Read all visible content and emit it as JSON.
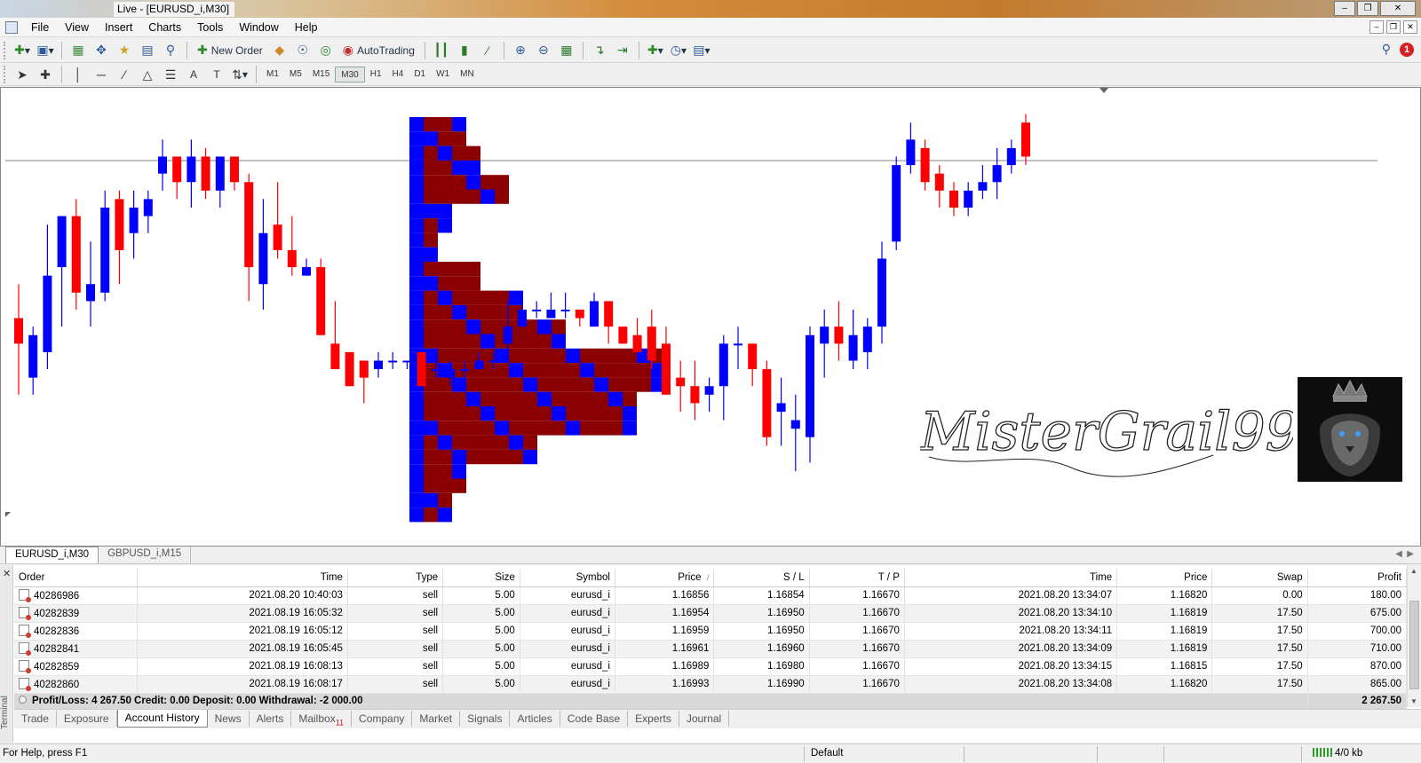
{
  "window": {
    "title": "Live - [EURUSD_i,M30]"
  },
  "menu": [
    "File",
    "View",
    "Insert",
    "Charts",
    "Tools",
    "Window",
    "Help"
  ],
  "toolbar": {
    "new_order": "New Order",
    "auto_trading": "AutoTrading",
    "timeframes": [
      "M1",
      "M5",
      "M15",
      "M30",
      "H1",
      "H4",
      "D1",
      "W1",
      "MN"
    ],
    "active_timeframe": "M30",
    "notification_count": "1"
  },
  "chart": {
    "watermark": "MisterGrail999©",
    "candles": [
      {
        "o": 1.1687,
        "h": 1.1691,
        "l": 1.1678,
        "c": 1.1684
      },
      {
        "o": 1.168,
        "h": 1.1686,
        "l": 1.1678,
        "c": 1.1685
      },
      {
        "o": 1.1683,
        "h": 1.1698,
        "l": 1.1681,
        "c": 1.1692
      },
      {
        "o": 1.1693,
        "h": 1.1699,
        "l": 1.1686,
        "c": 1.1699
      },
      {
        "o": 1.1699,
        "h": 1.1701,
        "l": 1.1688,
        "c": 1.169
      },
      {
        "o": 1.1689,
        "h": 1.1696,
        "l": 1.1686,
        "c": 1.1691
      },
      {
        "o": 1.169,
        "h": 1.1702,
        "l": 1.1689,
        "c": 1.17
      },
      {
        "o": 1.1701,
        "h": 1.1702,
        "l": 1.1691,
        "c": 1.1695
      },
      {
        "o": 1.1697,
        "h": 1.1702,
        "l": 1.1694,
        "c": 1.17
      },
      {
        "o": 1.1699,
        "h": 1.1702,
        "l": 1.1697,
        "c": 1.1701
      },
      {
        "o": 1.1704,
        "h": 1.1708,
        "l": 1.1702,
        "c": 1.1706
      },
      {
        "o": 1.1706,
        "h": 1.1706,
        "l": 1.1701,
        "c": 1.1703
      },
      {
        "o": 1.1703,
        "h": 1.1708,
        "l": 1.17,
        "c": 1.1706
      },
      {
        "o": 1.1706,
        "h": 1.1707,
        "l": 1.1701,
        "c": 1.1702
      },
      {
        "o": 1.1702,
        "h": 1.1706,
        "l": 1.17,
        "c": 1.1706
      },
      {
        "o": 1.1706,
        "h": 1.1706,
        "l": 1.1702,
        "c": 1.1703
      },
      {
        "o": 1.1703,
        "h": 1.1704,
        "l": 1.1689,
        "c": 1.1693
      },
      {
        "o": 1.1691,
        "h": 1.1701,
        "l": 1.1688,
        "c": 1.1697
      },
      {
        "o": 1.1698,
        "h": 1.1703,
        "l": 1.1694,
        "c": 1.1695
      },
      {
        "o": 1.1695,
        "h": 1.1699,
        "l": 1.1692,
        "c": 1.1693
      },
      {
        "o": 1.1692,
        "h": 1.1694,
        "l": 1.1692,
        "c": 1.1693
      },
      {
        "o": 1.1693,
        "h": 1.1694,
        "l": 1.1685,
        "c": 1.1685
      },
      {
        "o": 1.1684,
        "h": 1.1689,
        "l": 1.1682,
        "c": 1.1681
      },
      {
        "o": 1.1683,
        "h": 1.1681,
        "l": 1.1679,
        "c": 1.1679
      },
      {
        "o": 1.1682,
        "h": 1.168,
        "l": 1.1677,
        "c": 1.168
      },
      {
        "o": 1.1681,
        "h": 1.1683,
        "l": 1.168,
        "c": 1.1682
      },
      {
        "o": 1.1682,
        "h": 1.1683,
        "l": 1.1681,
        "c": 1.1682
      },
      {
        "o": 1.1682,
        "h": 1.1681,
        "l": 1.1681,
        "c": 1.1682
      },
      {
        "o": 1.1683,
        "h": 1.1681,
        "l": 1.168,
        "c": 1.1679
      },
      {
        "o": 1.1681,
        "h": 1.1683,
        "l": 1.168,
        "c": 1.1681
      },
      {
        "o": 1.168,
        "h": 1.1682,
        "l": 1.1679,
        "c": 1.1681
      },
      {
        "o": 1.1681,
        "h": 1.1682,
        "l": 1.168,
        "c": 1.1681
      },
      {
        "o": 1.1681,
        "h": 1.1683,
        "l": 1.1681,
        "c": 1.1682
      },
      {
        "o": 1.1682,
        "h": 1.1683,
        "l": 1.1681,
        "c": 1.1682
      },
      {
        "o": 1.1684,
        "h": 1.1689,
        "l": 1.1683,
        "c": 1.1686
      },
      {
        "o": 1.1686,
        "h": 1.1689,
        "l": 1.1686,
        "c": 1.1688
      },
      {
        "o": 1.1688,
        "h": 1.1689,
        "l": 1.1687,
        "c": 1.1688
      },
      {
        "o": 1.1687,
        "h": 1.169,
        "l": 1.1687,
        "c": 1.1688
      },
      {
        "o": 1.1688,
        "h": 1.169,
        "l": 1.1687,
        "c": 1.1688
      },
      {
        "o": 1.1688,
        "h": 1.1688,
        "l": 1.1686,
        "c": 1.1687
      },
      {
        "o": 1.1686,
        "h": 1.169,
        "l": 1.1686,
        "c": 1.1689
      },
      {
        "o": 1.1689,
        "h": 1.1689,
        "l": 1.1684,
        "c": 1.1686
      },
      {
        "o": 1.1686,
        "h": 1.1686,
        "l": 1.1684,
        "c": 1.1684
      },
      {
        "o": 1.1685,
        "h": 1.1687,
        "l": 1.1683,
        "c": 1.1683
      },
      {
        "o": 1.1686,
        "h": 1.1688,
        "l": 1.1681,
        "c": 1.1682
      },
      {
        "o": 1.1684,
        "h": 1.1686,
        "l": 1.1678,
        "c": 1.1678
      },
      {
        "o": 1.168,
        "h": 1.1682,
        "l": 1.1676,
        "c": 1.1679
      },
      {
        "o": 1.1679,
        "h": 1.1682,
        "l": 1.1675,
        "c": 1.1677
      },
      {
        "o": 1.1678,
        "h": 1.168,
        "l": 1.1676,
        "c": 1.1679
      },
      {
        "o": 1.1679,
        "h": 1.1685,
        "l": 1.1675,
        "c": 1.1684
      },
      {
        "o": 1.1684,
        "h": 1.1686,
        "l": 1.1681,
        "c": 1.1684
      },
      {
        "o": 1.1684,
        "h": 1.1684,
        "l": 1.1679,
        "c": 1.1681
      },
      {
        "o": 1.1681,
        "h": 1.1682,
        "l": 1.1672,
        "c": 1.1673
      },
      {
        "o": 1.1676,
        "h": 1.168,
        "l": 1.1672,
        "c": 1.1677
      },
      {
        "o": 1.1674,
        "h": 1.1678,
        "l": 1.1669,
        "c": 1.1675
      },
      {
        "o": 1.1673,
        "h": 1.1686,
        "l": 1.167,
        "c": 1.1685
      },
      {
        "o": 1.1684,
        "h": 1.1688,
        "l": 1.168,
        "c": 1.1686
      },
      {
        "o": 1.1686,
        "h": 1.1689,
        "l": 1.1682,
        "c": 1.1684
      },
      {
        "o": 1.1682,
        "h": 1.1688,
        "l": 1.1681,
        "c": 1.1685
      },
      {
        "o": 1.1683,
        "h": 1.1687,
        "l": 1.1681,
        "c": 1.1686
      },
      {
        "o": 1.1686,
        "h": 1.1696,
        "l": 1.1684,
        "c": 1.1694
      },
      {
        "o": 1.1696,
        "h": 1.1706,
        "l": 1.1695,
        "c": 1.1705
      },
      {
        "o": 1.1705,
        "h": 1.171,
        "l": 1.1704,
        "c": 1.1708
      },
      {
        "o": 1.1707,
        "h": 1.1708,
        "l": 1.1702,
        "c": 1.1703
      },
      {
        "o": 1.1704,
        "h": 1.1705,
        "l": 1.17,
        "c": 1.1702
      },
      {
        "o": 1.1702,
        "h": 1.1703,
        "l": 1.1699,
        "c": 1.17
      },
      {
        "o": 1.17,
        "h": 1.1703,
        "l": 1.1699,
        "c": 1.1702
      },
      {
        "o": 1.1702,
        "h": 1.1705,
        "l": 1.1701,
        "c": 1.1703
      },
      {
        "o": 1.1703,
        "h": 1.1707,
        "l": 1.1701,
        "c": 1.1705
      },
      {
        "o": 1.1705,
        "h": 1.1708,
        "l": 1.1704,
        "c": 1.1707
      },
      {
        "o": 1.171,
        "h": 1.1711,
        "l": 1.1705,
        "c": 1.1706
      }
    ]
  },
  "chart_tabs": [
    "EURUSD_i,M30",
    "GBPUSD_i,M15"
  ],
  "terminal": {
    "side_label": "Terminal",
    "columns": [
      "Order",
      "Time",
      "Type",
      "Size",
      "Symbol",
      "Price",
      "S / L",
      "T / P",
      "Time",
      "Price",
      "Swap",
      "Profit"
    ],
    "sort_indicator": "/",
    "rows": [
      [
        "40286986",
        "2021.08.20 10:40:03",
        "sell",
        "5.00",
        "eurusd_i",
        "1.16856",
        "1.16854",
        "1.16670",
        "2021.08.20 13:34:07",
        "1.16820",
        "0.00",
        "180.00"
      ],
      [
        "40282839",
        "2021.08.19 16:05:32",
        "sell",
        "5.00",
        "eurusd_i",
        "1.16954",
        "1.16950",
        "1.16670",
        "2021.08.20 13:34:10",
        "1.16819",
        "17.50",
        "675.00"
      ],
      [
        "40282836",
        "2021.08.19 16:05:12",
        "sell",
        "5.00",
        "eurusd_i",
        "1.16959",
        "1.16950",
        "1.16670",
        "2021.08.20 13:34:11",
        "1.16819",
        "17.50",
        "700.00"
      ],
      [
        "40282841",
        "2021.08.19 16:05:45",
        "sell",
        "5.00",
        "eurusd_i",
        "1.16961",
        "1.16960",
        "1.16670",
        "2021.08.20 13:34:09",
        "1.16819",
        "17.50",
        "710.00"
      ],
      [
        "40282859",
        "2021.08.19 16:08:13",
        "sell",
        "5.00",
        "eurusd_i",
        "1.16989",
        "1.16980",
        "1.16670",
        "2021.08.20 13:34:15",
        "1.16815",
        "17.50",
        "870.00"
      ],
      [
        "40282860",
        "2021.08.19 16:08:17",
        "sell",
        "5.00",
        "eurusd_i",
        "1.16993",
        "1.16990",
        "1.16670",
        "2021.08.20 13:34:08",
        "1.16820",
        "17.50",
        "865.00"
      ]
    ],
    "summary": "Profit/Loss: 4 267.50  Credit: 0.00  Deposit: 0.00  Withdrawal: -2 000.00",
    "summary_total": "2 267.50",
    "tabs": [
      "Trade",
      "Exposure",
      "Account History",
      "News",
      "Alerts",
      "Mailbox",
      "Company",
      "Market",
      "Signals",
      "Articles",
      "Code Base",
      "Experts",
      "Journal"
    ],
    "active_tab": "Account History",
    "mailbox_count": "11"
  },
  "status": {
    "help": "For Help, press F1",
    "profile": "Default",
    "traffic": "4/0 kb"
  },
  "colors": {
    "bull": "#0000ff",
    "bear": "#ff0000",
    "profile_dark": "#8b0000",
    "grid_line": "#808080"
  }
}
